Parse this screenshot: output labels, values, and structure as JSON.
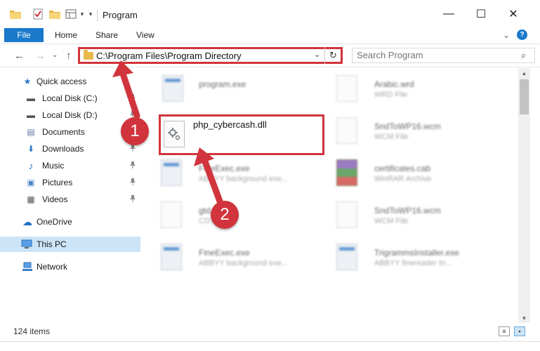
{
  "window": {
    "title": "Program",
    "minimize": "—",
    "maximize": "☐",
    "close": "✕"
  },
  "ribbon": {
    "tabs": [
      "File",
      "Home",
      "Share",
      "View"
    ],
    "expand_glyph": "⌄",
    "help_glyph": "?"
  },
  "navigation": {
    "back": "←",
    "forward": "→",
    "recent": "⌄",
    "up": "↑"
  },
  "address": {
    "path": "C:\\Program Files\\Program Directory",
    "dropdown_glyph": "⌄",
    "refresh_glyph": "↻"
  },
  "search": {
    "placeholder": "Search Program",
    "icon_glyph": "⌕"
  },
  "nav_pane": {
    "items": [
      {
        "label": "Quick access",
        "icon": "star-icon",
        "glyph": "★",
        "color": "#2a78c8",
        "pinned": false
      },
      {
        "label": "Local Disk (C:)",
        "icon": "drive-icon",
        "glyph": "▬",
        "color": "#555",
        "pinned": true
      },
      {
        "label": "Local Disk (D:)",
        "icon": "drive-icon",
        "glyph": "▬",
        "color": "#555",
        "pinned": true
      },
      {
        "label": "Documents",
        "icon": "documents-icon",
        "glyph": "▤",
        "color": "#5b7aa0",
        "pinned": true
      },
      {
        "label": "Downloads",
        "icon": "downloads-icon",
        "glyph": "⬇",
        "color": "#2a78c8",
        "pinned": true
      },
      {
        "label": "Music",
        "icon": "music-icon",
        "glyph": "♪",
        "color": "#2a78c8",
        "pinned": true
      },
      {
        "label": "Pictures",
        "icon": "pictures-icon",
        "glyph": "▣",
        "color": "#4a86c5",
        "pinned": true
      },
      {
        "label": "Videos",
        "icon": "videos-icon",
        "glyph": "▦",
        "color": "#555",
        "pinned": true
      },
      {
        "label": "OneDrive",
        "icon": "cloud-icon",
        "glyph": "☁",
        "color": "#1f6fc5",
        "pinned": false
      },
      {
        "label": "This PC",
        "icon": "computer-icon",
        "glyph": "▭",
        "color": "#2a78c8",
        "pinned": false
      },
      {
        "label": "Network",
        "icon": "network-icon",
        "glyph": "⊞",
        "color": "#2a78c8",
        "pinned": false
      }
    ],
    "pin_glyph": "📌"
  },
  "files": {
    "left": [
      {
        "name": "program.exe",
        "desc": "",
        "kind": "program"
      },
      {
        "name": "FineExec.exe",
        "desc": "ABBYY background exe...",
        "kind": "exe"
      },
      {
        "name": "gtd.cd",
        "desc": "CD File",
        "kind": "doc"
      },
      {
        "name": "FineExec.exe",
        "desc": "ABBYY background exe...",
        "kind": "exe"
      }
    ],
    "right": [
      {
        "name": "Arabic.wrd",
        "desc": "WRD File",
        "kind": "doc"
      },
      {
        "name": "SndToWP16.wcm",
        "desc": "WCM File",
        "kind": "doc"
      },
      {
        "name": "certificates.cab",
        "desc": "WinRAR Archive",
        "kind": "cab"
      },
      {
        "name": "SndToWP16.wcm",
        "desc": "WCM File",
        "kind": "doc"
      },
      {
        "name": "TrigrammsInstaller.exe",
        "desc": "ABBYY finereader tri...",
        "kind": "exe"
      }
    ],
    "highlighted": {
      "name": "php_cybercash.dll",
      "icon": "gear-file-icon"
    }
  },
  "status": {
    "count": "124 items"
  },
  "annotations": {
    "step1": "1",
    "step2": "2",
    "color": "#d1343c"
  }
}
